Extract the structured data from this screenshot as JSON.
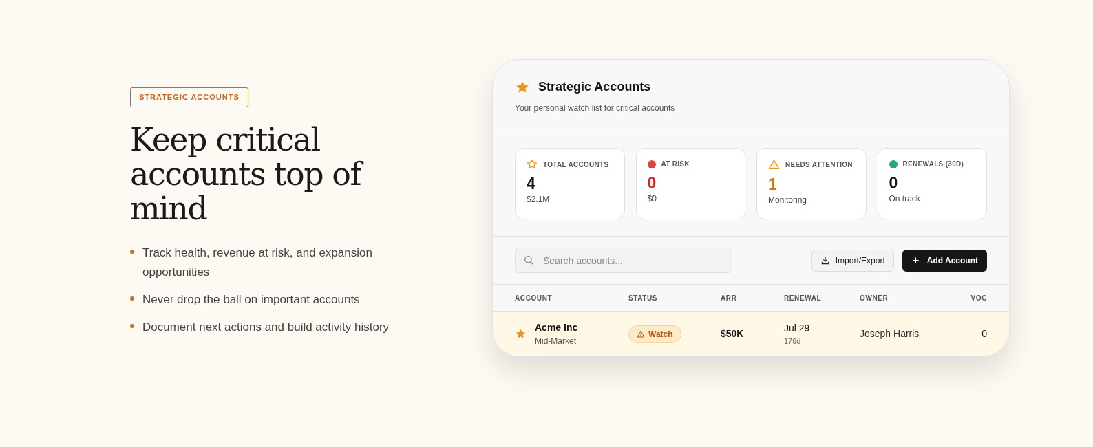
{
  "intro": {
    "badge": "STRATEGIC ACCOUNTS",
    "heading": "Keep critical accounts top of mind",
    "bullets": [
      "Track health, revenue at risk, and expansion opportunities",
      "Never drop the ball on important accounts",
      "Document next actions and build activity history"
    ]
  },
  "panel": {
    "title": "Strategic Accounts",
    "subtitle": "Your personal watch list for critical accounts",
    "stats": [
      {
        "kind": "star",
        "label": "TOTAL ACCOUNTS",
        "value": {
          "text": "4",
          "color": "#151515"
        },
        "note": "$2.1M"
      },
      {
        "kind": "dot",
        "color": "#e5413e",
        "label": "AT RISK",
        "value": {
          "text": "0",
          "color": "#d42a24"
        },
        "note": "$0"
      },
      {
        "kind": "warning",
        "label": "NEEDS ATTENTION",
        "value": {
          "text": "1",
          "color": "#d9731a"
        },
        "note": "Monitoring"
      },
      {
        "kind": "dot",
        "color": "#22a874",
        "label": "RENEWALS (30D)",
        "value": {
          "text": "0",
          "color": "#151515"
        },
        "note": "On track"
      }
    ],
    "search": {
      "placeholder": "Search accounts..."
    },
    "buttons": [
      {
        "kind": "secondary",
        "label": "Import/Export"
      },
      {
        "kind": "primary",
        "label": "Add Account"
      }
    ],
    "table": {
      "columns": [
        "ACCOUNT",
        "STATUS",
        "ARR",
        "RENEWAL",
        "OWNER",
        "VOC"
      ],
      "rows": [
        {
          "starred": true,
          "name": "Acme Inc",
          "segment": "Mid-Market",
          "status": "Watch",
          "arr": "$50K",
          "renewal": "Jul 29",
          "days": "179d",
          "owner": "Joseph Harris",
          "voc": "0"
        }
      ]
    }
  }
}
